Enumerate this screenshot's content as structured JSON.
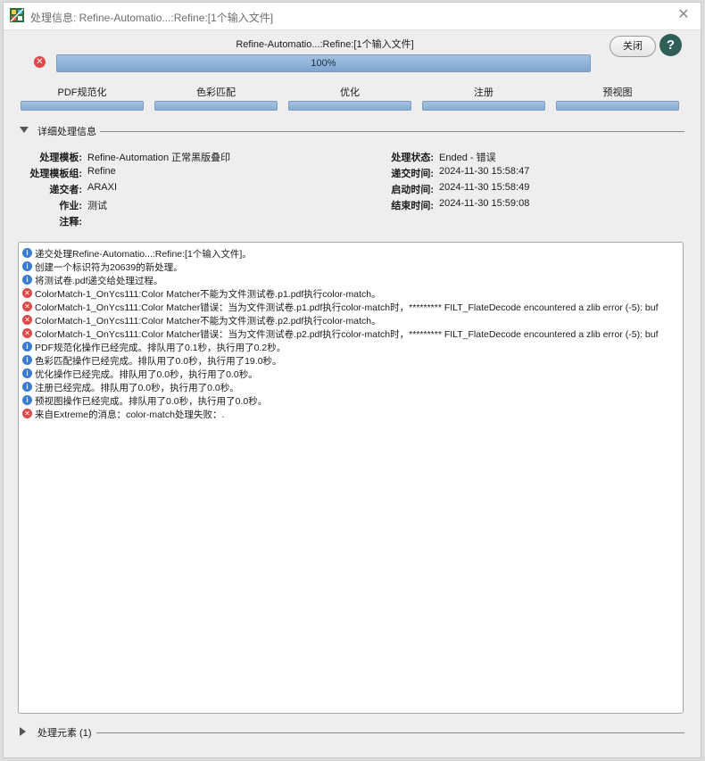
{
  "window": {
    "title": "处理信息: Refine-Automatio...:Refine:[1个输入文件]",
    "close_glyph": "✕"
  },
  "header": {
    "job_name": "Refine-Automatio...:Refine:[1个输入文件]",
    "progress_text": "100%",
    "progress_fraction": 1.0,
    "close_label": "关闭",
    "help_label": "?"
  },
  "stages": [
    "PDF规范化",
    "色彩匹配",
    "优化",
    "注册",
    "预视图"
  ],
  "details_section": {
    "label": "详细处理信息"
  },
  "details": {
    "template_label": "处理模板:",
    "template": "Refine-Automation 正常黑版叠印",
    "template_group_label": "处理模板组:",
    "template_group": "Refine",
    "submitter_label": "递交者:",
    "submitter": "ARAXI",
    "job_label": "作业:",
    "job": "测试",
    "note_label": "注释:",
    "note": "",
    "status_label": "处理状态:",
    "status": "Ended - 错误",
    "submit_time_label": "递交时间:",
    "submit_time": "2024-11-30 15:58:47",
    "start_time_label": "启动时间:",
    "start_time": "2024-11-30 15:58:49",
    "end_time_label": "结束时间:",
    "end_time": "2024-11-30 15:59:08"
  },
  "log": [
    {
      "type": "info",
      "text": "递交处理Refine-Automatio...:Refine:[1个输入文件]。"
    },
    {
      "type": "info",
      "text": "创建一个标识符为20639的新处理。"
    },
    {
      "type": "info",
      "text": "将测试卷.pdf递交给处理过程。"
    },
    {
      "type": "err",
      "text": "ColorMatch-1_OnYcs111:Color Matcher不能为文件测试卷.p1.pdf执行color-match。"
    },
    {
      "type": "err",
      "text": "ColorMatch-1_OnYcs111:Color Matcher错误：当为文件测试卷.p1.pdf执行color-match时，********* FILT_FlateDecode encountered a zlib error (-5): buf"
    },
    {
      "type": "err",
      "text": "ColorMatch-1_OnYcs111:Color Matcher不能为文件测试卷.p2.pdf执行color-match。"
    },
    {
      "type": "err",
      "text": "ColorMatch-1_OnYcs111:Color Matcher错误：当为文件测试卷.p2.pdf执行color-match时，********* FILT_FlateDecode encountered a zlib error (-5): buf"
    },
    {
      "type": "info",
      "text": "PDF规范化操作已经完成。排队用了0.1秒，执行用了0.2秒。"
    },
    {
      "type": "info",
      "text": "色彩匹配操作已经完成。排队用了0.0秒，执行用了19.0秒。"
    },
    {
      "type": "info",
      "text": "优化操作已经完成。排队用了0.0秒，执行用了0.0秒。"
    },
    {
      "type": "info",
      "text": "注册已经完成。排队用了0.0秒，执行用了0.0秒。"
    },
    {
      "type": "info",
      "text": "预视图操作已经完成。排队用了0.0秒，执行用了0.0秒。"
    },
    {
      "type": "err",
      "text": "来自Extreme的消息：color-match处理失败：."
    }
  ],
  "elements_section": {
    "label": "处理元素 (1)"
  },
  "colors": {
    "progress_blue": "#86acd3",
    "error_red": "#e04848",
    "info_blue": "#3a7bd5",
    "help_green": "#2f5f58"
  }
}
